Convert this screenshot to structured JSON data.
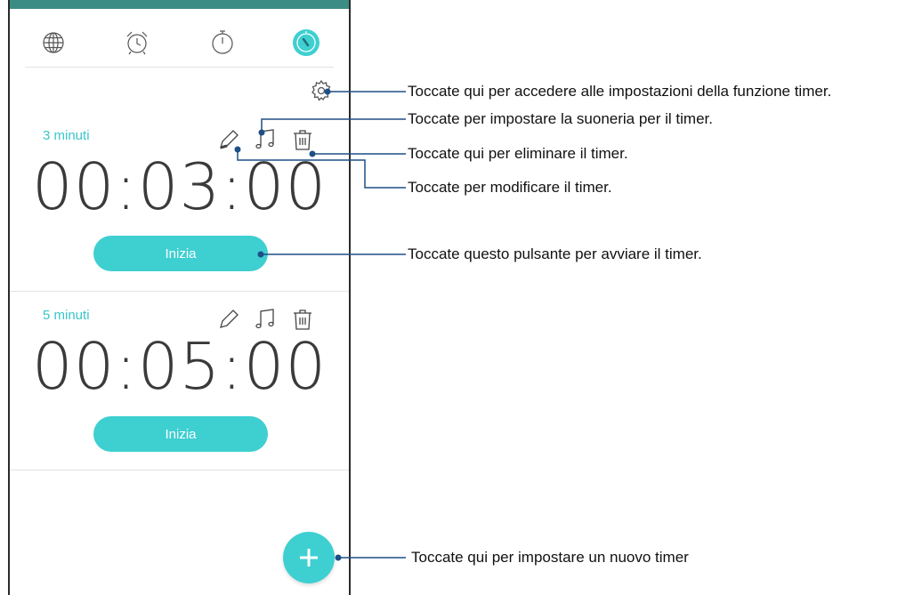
{
  "app": {
    "tabs": [
      {
        "icon": "globe-icon",
        "label": "World clock"
      },
      {
        "icon": "alarm-clock-icon",
        "label": "Alarm"
      },
      {
        "icon": "stopwatch-icon",
        "label": "Stopwatch"
      },
      {
        "icon": "timer-icon",
        "label": "Timer",
        "active": true
      }
    ],
    "settings_icon": "gear-icon",
    "accent_color": "#3ecfd1",
    "timers": [
      {
        "label": "3 minuti",
        "time": "00:03:00",
        "start_label": "Inizia"
      },
      {
        "label": "5 minuti",
        "time": "00:05:00",
        "start_label": "Inizia"
      }
    ],
    "fab_icon": "plus-icon"
  },
  "callouts": {
    "settings": "Toccate qui per accedere alle impostazioni della funzione timer.",
    "ringtone": "Toccate per impostare la suoneria per il timer.",
    "delete": "Toccate qui per eliminare il timer.",
    "edit": "Toccate per modificare il timer.",
    "start": "Toccate questo pulsante per avviare il timer.",
    "new_timer": "Toccate qui per impostare un nuovo timer"
  }
}
